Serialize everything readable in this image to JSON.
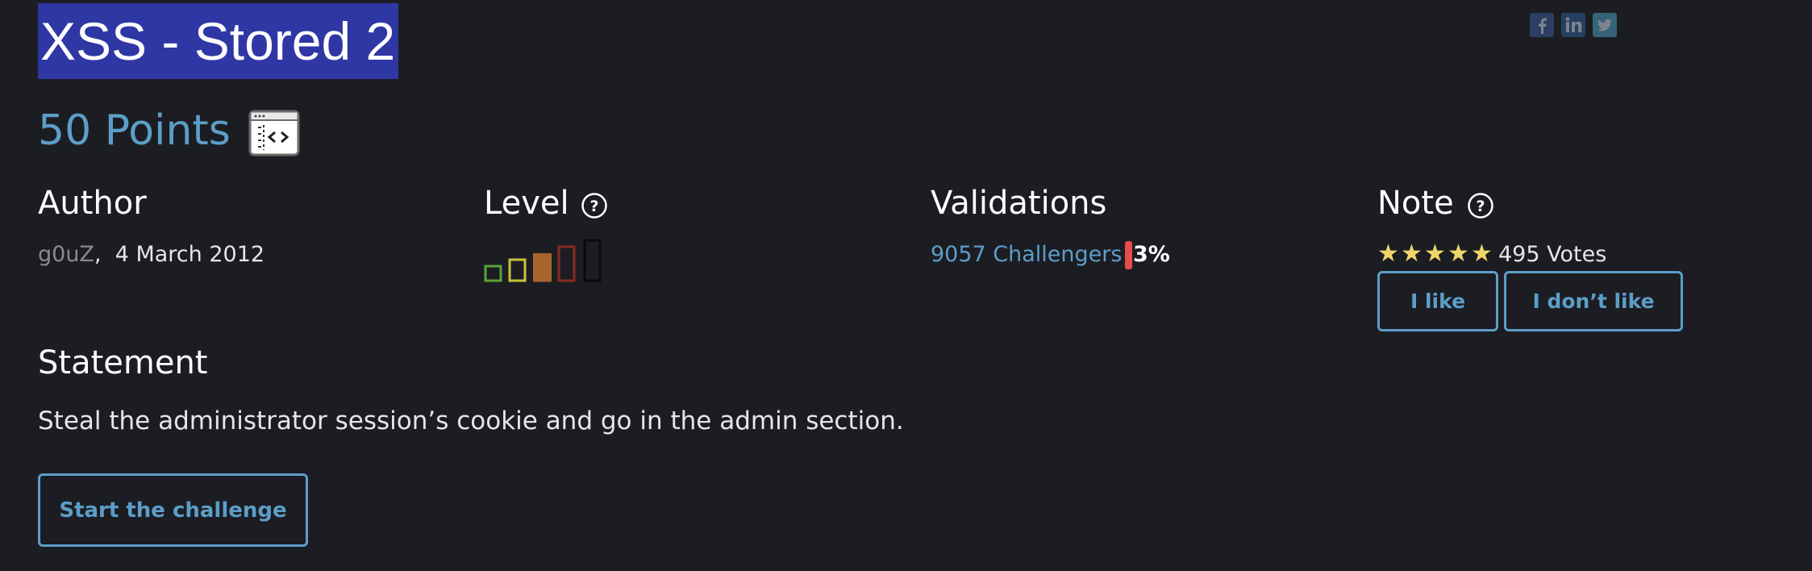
{
  "challenge": {
    "title": "XSS - Stored 2",
    "points": "50 Points",
    "category_icon": "web-client-icon"
  },
  "social": [
    {
      "name": "facebook-icon",
      "label": "f"
    },
    {
      "name": "linkedin-icon",
      "label": "in"
    },
    {
      "name": "twitter-icon",
      "label": "t"
    }
  ],
  "author": {
    "heading": "Author",
    "name": "g0uZ",
    "separator": ",",
    "date": "4 March 2012"
  },
  "level": {
    "heading": "Level",
    "current": 3,
    "max": 5,
    "colors": [
      "#5aa33a",
      "#c9c23c",
      "#a8642e",
      "#8b2a22",
      "#0a0a0a"
    ]
  },
  "validations": {
    "heading": "Validations",
    "challengers": "9057 Challengers",
    "percent": "3%"
  },
  "note": {
    "heading": "Note",
    "stars": 5,
    "votes": "495 Votes",
    "like_label": "I like",
    "dislike_label": "I don’t like"
  },
  "statement": {
    "heading": "Statement",
    "text": "Steal the administrator session’s cookie and go in the admin section."
  },
  "start_label": "Start the challenge",
  "colors": {
    "background": "#1c1d22",
    "accent": "#5c9ec9",
    "title_highlight": "#2f37a5",
    "star": "#f0d56b",
    "percent_bar": "#e74c4c"
  }
}
